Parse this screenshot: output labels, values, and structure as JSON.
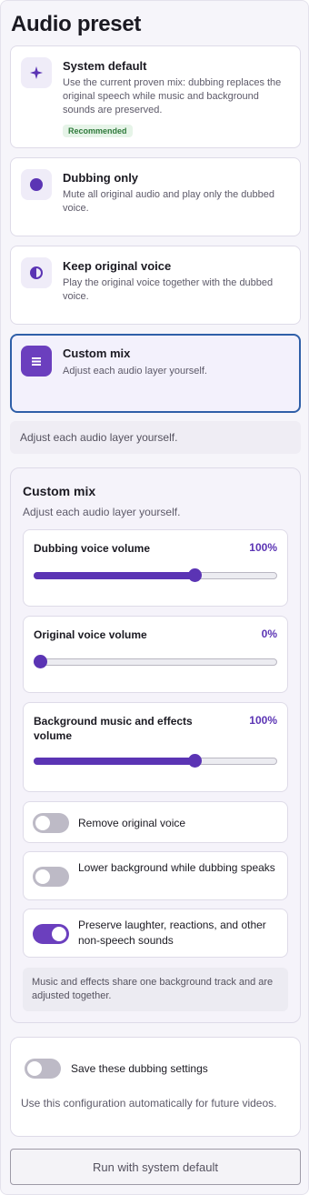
{
  "title": "Audio preset",
  "presets": [
    {
      "icon": "sparkle-icon",
      "title": "System default",
      "description": "Use the current proven mix: dubbing replaces the original speech while music and background sounds are preserved.",
      "badge": "Recommended",
      "selected": false
    },
    {
      "icon": "circle-icon",
      "title": "Dubbing only",
      "description": "Mute all original audio and play only the dubbed voice.",
      "selected": false
    },
    {
      "icon": "half-circle-icon",
      "title": "Keep original voice",
      "description": "Play the original voice together with the dubbed voice.",
      "selected": false
    },
    {
      "icon": "sliders-icon",
      "title": "Custom mix",
      "description": "Adjust each audio layer yourself.",
      "selected": true
    }
  ],
  "selected_description": "Adjust each audio layer yourself.",
  "custom_mix": {
    "title": "Custom mix",
    "subtitle": "Adjust each audio layer yourself.",
    "sliders": [
      {
        "label": "Dubbing voice volume",
        "value_text": "100%",
        "position": 0.66
      },
      {
        "label": "Original voice volume",
        "value_text": "0%",
        "position": 0.0
      },
      {
        "label": "Background music and effects volume",
        "value_text": "100%",
        "position": 0.66
      }
    ],
    "toggles": [
      {
        "label": "Remove original voice",
        "on": false
      },
      {
        "label": "Lower background while dubbing speaks",
        "on": false
      },
      {
        "label": "Preserve laughter, reactions, and other non-speech sounds",
        "on": true
      }
    ],
    "note": "Music and effects share one background track and are adjusted together."
  },
  "save_settings": {
    "label": "Save these dubbing settings",
    "on": false,
    "description": "Use this configuration automatically for future videos."
  },
  "run_button": "Run with system default",
  "colors": {
    "accent": "#5b34b4",
    "selected_border": "#2f5fa8"
  }
}
